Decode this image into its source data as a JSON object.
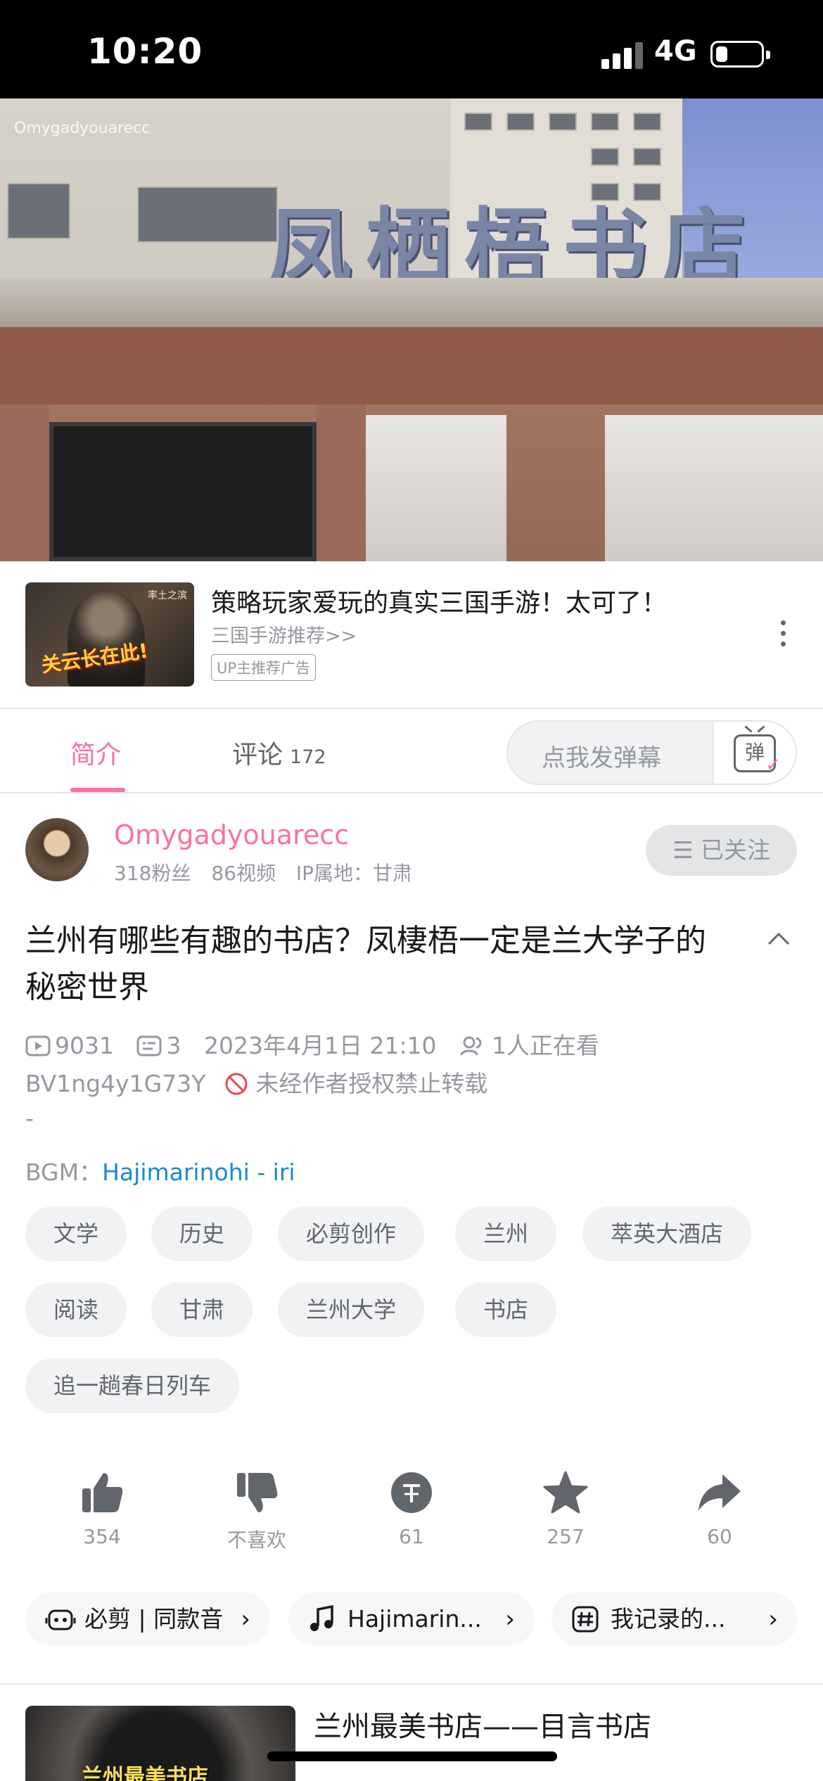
{
  "status_bar": {
    "time": "10:20",
    "network": "4G",
    "battery_percent": 25
  },
  "video": {
    "sign_text": "凤栖梧书店",
    "watermark": "Omygadyouarecc"
  },
  "ad": {
    "thumb_text": "关云长在此!",
    "thumb_corner": "率土之滨",
    "title": "策略玩家爱玩的真实三国手游！太可了！",
    "subtitle": "三国手游推荐>>",
    "badge": "UP主推荐广告"
  },
  "tabs": {
    "intro": "简介",
    "comments": "评论",
    "comments_count": "172",
    "danmaku_placeholder": "点我发弹幕",
    "danmaku_icon_char": "弹"
  },
  "uploader": {
    "name": "Omygadyouarecc",
    "fans": "318粉丝",
    "videos": "86视频",
    "ip": "IP属地：甘肃",
    "follow_label": "☰ 已关注"
  },
  "video_info": {
    "title": "兰州有哪些有趣的书店？凤棲梧一定是兰大学子的秘密世界",
    "views": "9031",
    "danmaku_count": "3",
    "datetime": "2023年4月1日 21:10",
    "watching": "1人正在看",
    "bvid": "BV1ng4y1G73Y",
    "repost_notice": "未经作者授权禁止转载",
    "dash": "-",
    "bgm_label": "BGM：",
    "bgm_song": "Hajimarinohi - iri"
  },
  "tags": [
    "文学",
    "历史",
    "必剪创作",
    "兰州",
    "萃英大酒店",
    "阅读",
    "甘肃",
    "兰州大学",
    "书店",
    "追一趟春日列车"
  ],
  "actions": {
    "like": "354",
    "dislike": "不喜欢",
    "coin": "61",
    "favorite": "257",
    "share": "60"
  },
  "chips": {
    "bijian": "必剪 | 同款音",
    "music": "Hajimarin...",
    "record": "我记录的..."
  },
  "recommend": {
    "title": "兰州最美书店——目言书店",
    "thumb_caption": "兰州最美书店"
  }
}
